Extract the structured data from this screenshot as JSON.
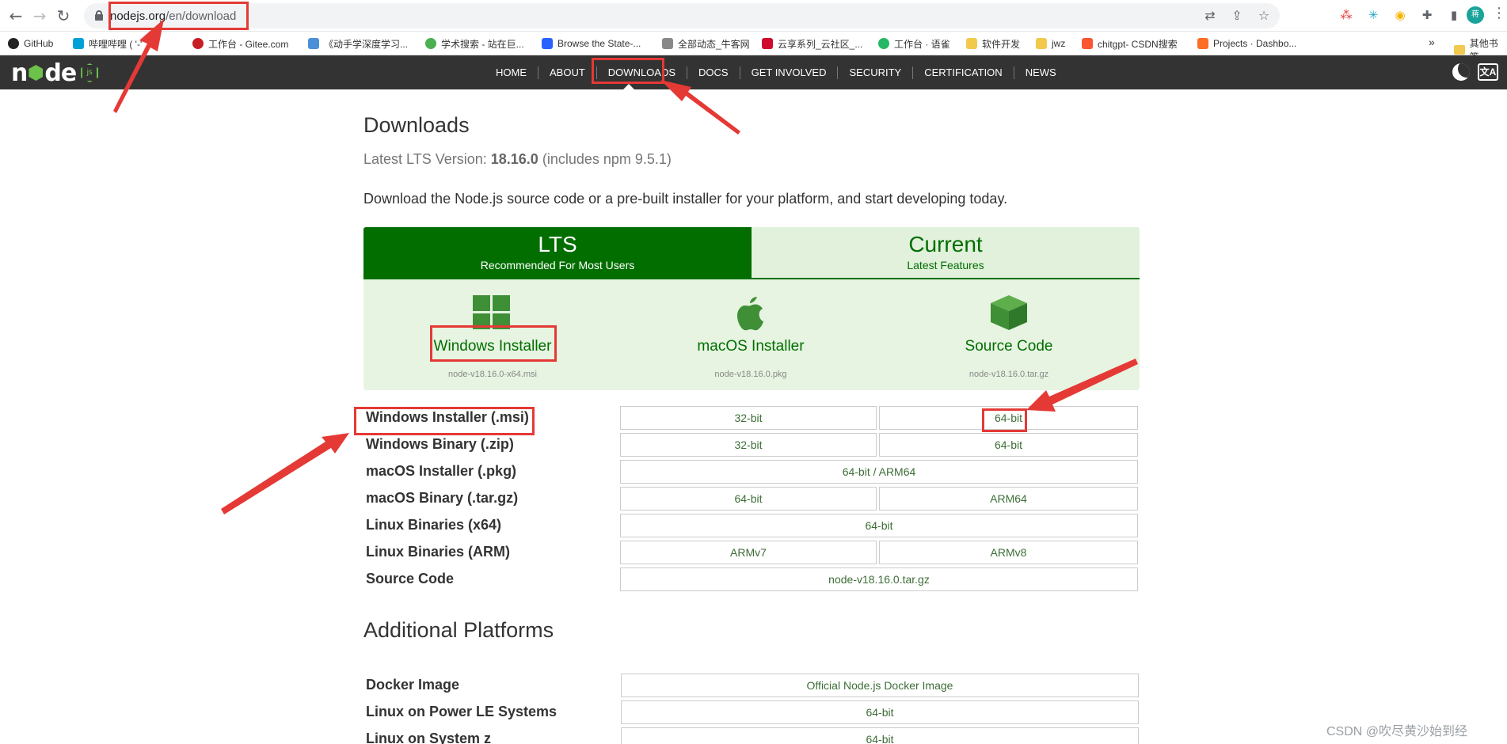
{
  "browser": {
    "url_host": "nodejs.org",
    "url_path": "/en/download",
    "bookmarks": [
      "GitHub",
      "哔哩哔哩 ( '-'",
      "工作台 - Gitee.com",
      "《动手学深度学习...",
      "学术搜索 - 站在巨...",
      "Browse the State-...",
      "全部动态_牛客网",
      "云享系列_云社区_...",
      "工作台 · 语雀",
      "软件开发",
      "jwz",
      "chitgpt- CSDN搜索",
      "Projects · Dashbo..."
    ],
    "bookmarks_more": "»",
    "bookmarks_other": "其他书签",
    "profile_initial": "蒋"
  },
  "nav": {
    "logo_text": "node",
    "logo_js": "js",
    "items": [
      "HOME",
      "ABOUT",
      "DOWNLOADS",
      "DOCS",
      "GET INVOLVED",
      "SECURITY",
      "CERTIFICATION",
      "NEWS"
    ],
    "active": "DOWNLOADS",
    "lang": "文A"
  },
  "page": {
    "title": "Downloads",
    "lts_prefix": "Latest LTS Version: ",
    "lts_version": "18.16.0",
    "lts_suffix": " (includes npm 9.5.1)",
    "intro": "Download the Node.js source code or a pre-built installer for your platform, and start developing today."
  },
  "tabs": [
    {
      "title": "LTS",
      "subtitle": "Recommended For Most Users"
    },
    {
      "title": "Current",
      "subtitle": "Latest Features"
    }
  ],
  "options": [
    {
      "label": "Windows Installer",
      "file": "node-v18.16.0-x64.msi"
    },
    {
      "label": "macOS Installer",
      "file": "node-v18.16.0.pkg"
    },
    {
      "label": "Source Code",
      "file": "node-v18.16.0.tar.gz"
    }
  ],
  "table": [
    {
      "label": "Windows Installer (.msi)",
      "cells": [
        "32-bit",
        "64-bit"
      ]
    },
    {
      "label": "Windows Binary (.zip)",
      "cells": [
        "32-bit",
        "64-bit"
      ]
    },
    {
      "label": "macOS Installer (.pkg)",
      "cells": [
        "64-bit / ARM64"
      ]
    },
    {
      "label": "macOS Binary (.tar.gz)",
      "cells": [
        "64-bit",
        "ARM64"
      ]
    },
    {
      "label": "Linux Binaries (x64)",
      "cells": [
        "64-bit"
      ]
    },
    {
      "label": "Linux Binaries (ARM)",
      "cells": [
        "ARMv7",
        "ARMv8"
      ]
    },
    {
      "label": "Source Code",
      "cells": [
        "node-v18.16.0.tar.gz"
      ]
    }
  ],
  "additional": {
    "title": "Additional Platforms",
    "rows": [
      {
        "label": "Docker Image",
        "cell": "Official Node.js Docker Image"
      },
      {
        "label": "Linux on Power LE Systems",
        "cell": "64-bit"
      },
      {
        "label": "Linux on System z",
        "cell": "64-bit"
      }
    ]
  },
  "watermark": "CSDN @吹尽黄沙始到经",
  "colors": {
    "node_green": "#026e00",
    "annotation_red": "#e53935",
    "header_bg": "#333333"
  }
}
